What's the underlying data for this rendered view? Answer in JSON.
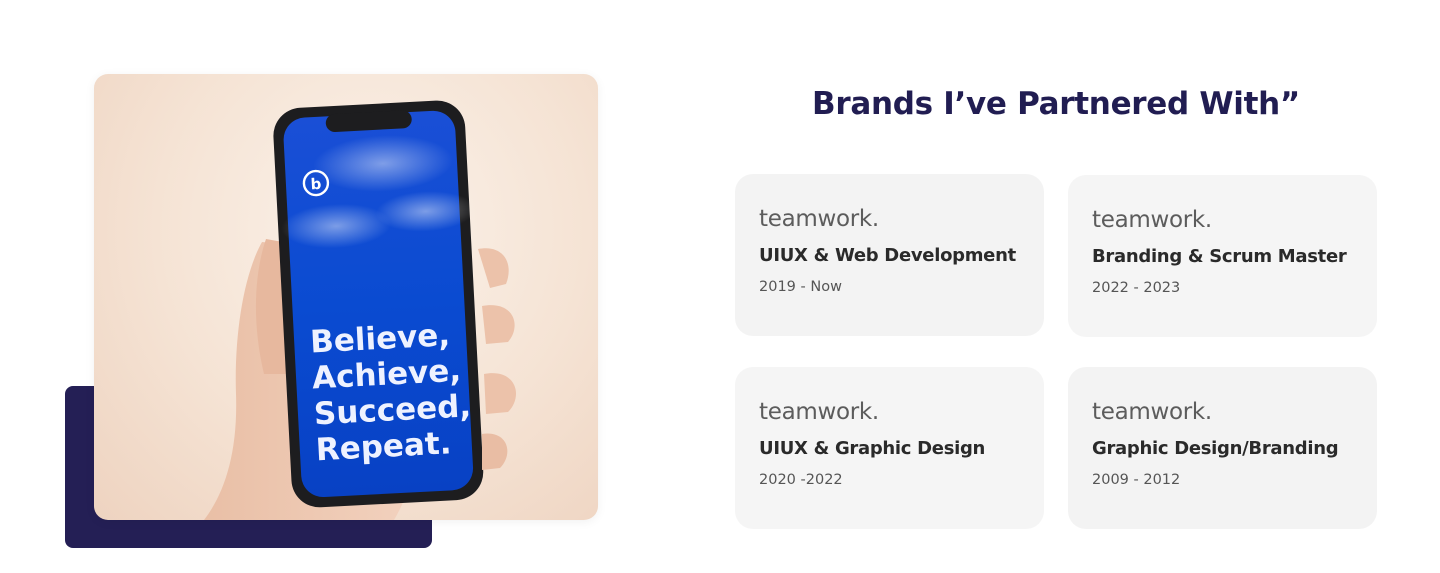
{
  "photo": {
    "screen_text": [
      "Believe,",
      "Achieve,",
      "Succeed,",
      "Repeat."
    ],
    "app_logo_letter": "b",
    "colors": {
      "screen": "#0a4bd1",
      "accent_block": "#241f55"
    }
  },
  "section": {
    "title": "Brands I’ve Partnered With”"
  },
  "partners": [
    {
      "brand": "teamwork.",
      "role": "UIUX & Web Development",
      "period": "2019 - Now"
    },
    {
      "brand": "teamwork.",
      "role": "Branding & Scrum Master",
      "period": "2022 - 2023"
    },
    {
      "brand": "teamwork.",
      "role": "UIUX & Graphic Design",
      "period": "2020 -2022"
    },
    {
      "brand": "teamwork.",
      "role": "Graphic Design/Branding",
      "period": "2009 - 2012"
    }
  ],
  "theme": {
    "title_color": "#211d52",
    "card_background": "#f3f3f3"
  }
}
